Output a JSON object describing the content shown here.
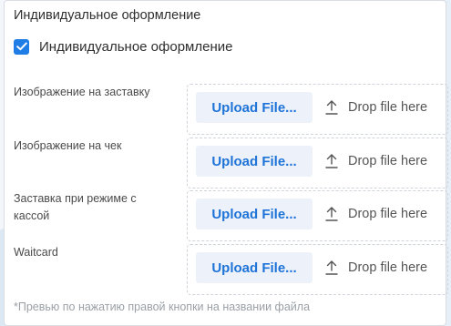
{
  "section": {
    "title": "Индивидуальное оформление"
  },
  "checkbox": {
    "label": "Индивидуальное оформление",
    "checked": true,
    "color": "#1e7ee6"
  },
  "upload_rows": [
    {
      "label": "Изображение на заставку",
      "button": "Upload File...",
      "drop_text": "Drop file here"
    },
    {
      "label": "Изображение на чек",
      "button": "Upload File...",
      "drop_text": "Drop file here"
    },
    {
      "label": "Заставка при режиме с кассой",
      "button": "Upload File...",
      "drop_text": "Drop file here"
    },
    {
      "label": "Waitcard",
      "button": "Upload File...",
      "drop_text": "Drop file here"
    }
  ],
  "icons": {
    "upload": "upload-icon",
    "check": "check-icon"
  },
  "footnote": "*Превью по нажатию правой кнопки на названии файла"
}
